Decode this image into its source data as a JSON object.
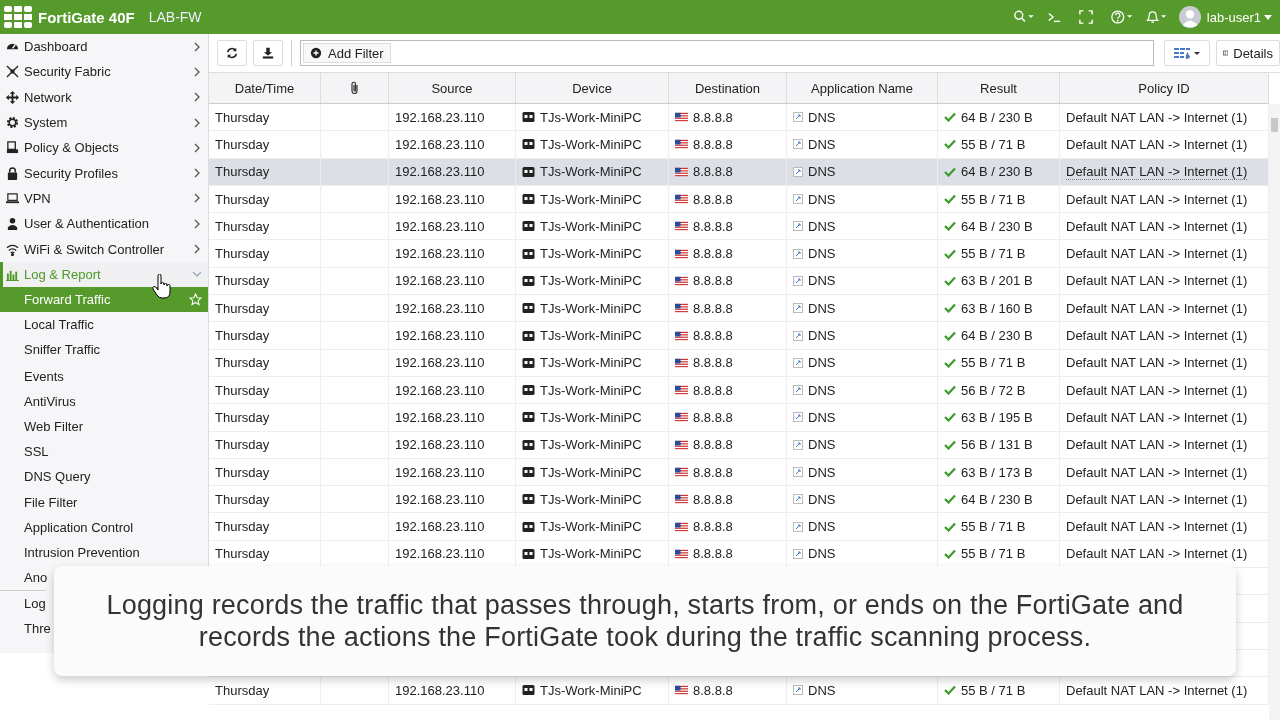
{
  "header": {
    "product": "FortiGate 40F",
    "hostname": "LAB-FW",
    "user": "lab-user1"
  },
  "sidebar": {
    "items": [
      {
        "label": "Dashboard",
        "expanded": false
      },
      {
        "label": "Security Fabric",
        "expanded": false
      },
      {
        "label": "Network",
        "expanded": false
      },
      {
        "label": "System",
        "expanded": false
      },
      {
        "label": "Policy & Objects",
        "expanded": false
      },
      {
        "label": "Security Profiles",
        "expanded": false
      },
      {
        "label": "VPN",
        "expanded": false
      },
      {
        "label": "User & Authentication",
        "expanded": false
      },
      {
        "label": "WiFi & Switch Controller",
        "expanded": false
      },
      {
        "label": "Log & Report",
        "expanded": true,
        "children": [
          {
            "label": "Forward Traffic",
            "selected": true
          },
          {
            "label": "Local Traffic",
            "selected": false
          },
          {
            "label": "Sniffer Traffic",
            "selected": false
          },
          {
            "label": "Events",
            "selected": false
          },
          {
            "label": "AntiVirus",
            "selected": false
          },
          {
            "label": "Web Filter",
            "selected": false
          },
          {
            "label": "SSL",
            "selected": false
          },
          {
            "label": "DNS Query",
            "selected": false
          },
          {
            "label": "File Filter",
            "selected": false
          },
          {
            "label": "Application Control",
            "selected": false
          },
          {
            "label": "Intrusion Prevention",
            "selected": false
          },
          {
            "label": "Ano",
            "selected": false
          },
          {
            "label": "Log",
            "selected": false
          },
          {
            "label": "Thre",
            "selected": false
          }
        ]
      }
    ]
  },
  "toolbar": {
    "filter_button": "Add Filter",
    "details_button": "Details"
  },
  "table": {
    "columns": [
      "Date/Time",
      "",
      "Source",
      "Device",
      "Destination",
      "Application Name",
      "Result",
      "Policy ID"
    ],
    "rows": [
      {
        "date": "Thursday",
        "source": "192.168.23.110",
        "device": "TJs-Work-MiniPC",
        "destination": "8.8.8.8",
        "app": "DNS",
        "result": "64 B / 230 B",
        "policy": "Default NAT LAN -> Internet (1)",
        "selected": false
      },
      {
        "date": "Thursday",
        "source": "192.168.23.110",
        "device": "TJs-Work-MiniPC",
        "destination": "8.8.8.8",
        "app": "DNS",
        "result": "55 B / 71 B",
        "policy": "Default NAT LAN -> Internet (1)",
        "selected": false
      },
      {
        "date": "Thursday",
        "source": "192.168.23.110",
        "device": "TJs-Work-MiniPC",
        "destination": "8.8.8.8",
        "app": "DNS",
        "result": "64 B / 230 B",
        "policy": "Default NAT LAN -> Internet (1)",
        "selected": true
      },
      {
        "date": "Thursday",
        "source": "192.168.23.110",
        "device": "TJs-Work-MiniPC",
        "destination": "8.8.8.8",
        "app": "DNS",
        "result": "55 B / 71 B",
        "policy": "Default NAT LAN -> Internet (1)",
        "selected": false
      },
      {
        "date": "Thursday",
        "source": "192.168.23.110",
        "device": "TJs-Work-MiniPC",
        "destination": "8.8.8.8",
        "app": "DNS",
        "result": "64 B / 230 B",
        "policy": "Default NAT LAN -> Internet (1)",
        "selected": false
      },
      {
        "date": "Thursday",
        "source": "192.168.23.110",
        "device": "TJs-Work-MiniPC",
        "destination": "8.8.8.8",
        "app": "DNS",
        "result": "55 B / 71 B",
        "policy": "Default NAT LAN -> Internet (1)",
        "selected": false
      },
      {
        "date": "Thursday",
        "source": "192.168.23.110",
        "device": "TJs-Work-MiniPC",
        "destination": "8.8.8.8",
        "app": "DNS",
        "result": "63 B / 201 B",
        "policy": "Default NAT LAN -> Internet (1)",
        "selected": false
      },
      {
        "date": "Thursday",
        "source": "192.168.23.110",
        "device": "TJs-Work-MiniPC",
        "destination": "8.8.8.8",
        "app": "DNS",
        "result": "63 B / 160 B",
        "policy": "Default NAT LAN -> Internet (1)",
        "selected": false
      },
      {
        "date": "Thursday",
        "source": "192.168.23.110",
        "device": "TJs-Work-MiniPC",
        "destination": "8.8.8.8",
        "app": "DNS",
        "result": "64 B / 230 B",
        "policy": "Default NAT LAN -> Internet (1)",
        "selected": false
      },
      {
        "date": "Thursday",
        "source": "192.168.23.110",
        "device": "TJs-Work-MiniPC",
        "destination": "8.8.8.8",
        "app": "DNS",
        "result": "55 B / 71 B",
        "policy": "Default NAT LAN -> Internet (1)",
        "selected": false
      },
      {
        "date": "Thursday",
        "source": "192.168.23.110",
        "device": "TJs-Work-MiniPC",
        "destination": "8.8.8.8",
        "app": "DNS",
        "result": "56 B / 72 B",
        "policy": "Default NAT LAN -> Internet (1)",
        "selected": false
      },
      {
        "date": "Thursday",
        "source": "192.168.23.110",
        "device": "TJs-Work-MiniPC",
        "destination": "8.8.8.8",
        "app": "DNS",
        "result": "63 B / 195 B",
        "policy": "Default NAT LAN -> Internet (1)",
        "selected": false
      },
      {
        "date": "Thursday",
        "source": "192.168.23.110",
        "device": "TJs-Work-MiniPC",
        "destination": "8.8.8.8",
        "app": "DNS",
        "result": "56 B / 131 B",
        "policy": "Default NAT LAN -> Internet (1)",
        "selected": false
      },
      {
        "date": "Thursday",
        "source": "192.168.23.110",
        "device": "TJs-Work-MiniPC",
        "destination": "8.8.8.8",
        "app": "DNS",
        "result": "63 B / 173 B",
        "policy": "Default NAT LAN -> Internet (1)",
        "selected": false
      },
      {
        "date": "Thursday",
        "source": "192.168.23.110",
        "device": "TJs-Work-MiniPC",
        "destination": "8.8.8.8",
        "app": "DNS",
        "result": "64 B / 230 B",
        "policy": "Default NAT LAN -> Internet (1)",
        "selected": false
      },
      {
        "date": "Thursday",
        "source": "192.168.23.110",
        "device": "TJs-Work-MiniPC",
        "destination": "8.8.8.8",
        "app": "DNS",
        "result": "55 B / 71 B",
        "policy": "Default NAT LAN -> Internet (1)",
        "selected": false
      },
      {
        "date": "Thursday",
        "source": "192.168.23.110",
        "device": "TJs-Work-MiniPC",
        "destination": "8.8.8.8",
        "app": "DNS",
        "result": "55 B / 71 B",
        "policy": "Default NAT LAN -> Internet (1)",
        "selected": false
      }
    ],
    "rows_below_caption": [
      {
        "date": "Thursday",
        "source": "192.168.23.110",
        "device": "TJs-Work-MiniPC",
        "destination": "8.8.8.8",
        "app": "DNS",
        "result": "55 B / 71 B",
        "policy": "Default NAT LAN -> Internet (1)",
        "selected": false
      }
    ]
  },
  "caption": "Logging records the traffic that passes through, starts from, or ends on the FortiGate and records the actions the FortiGate took during the traffic scanning process."
}
